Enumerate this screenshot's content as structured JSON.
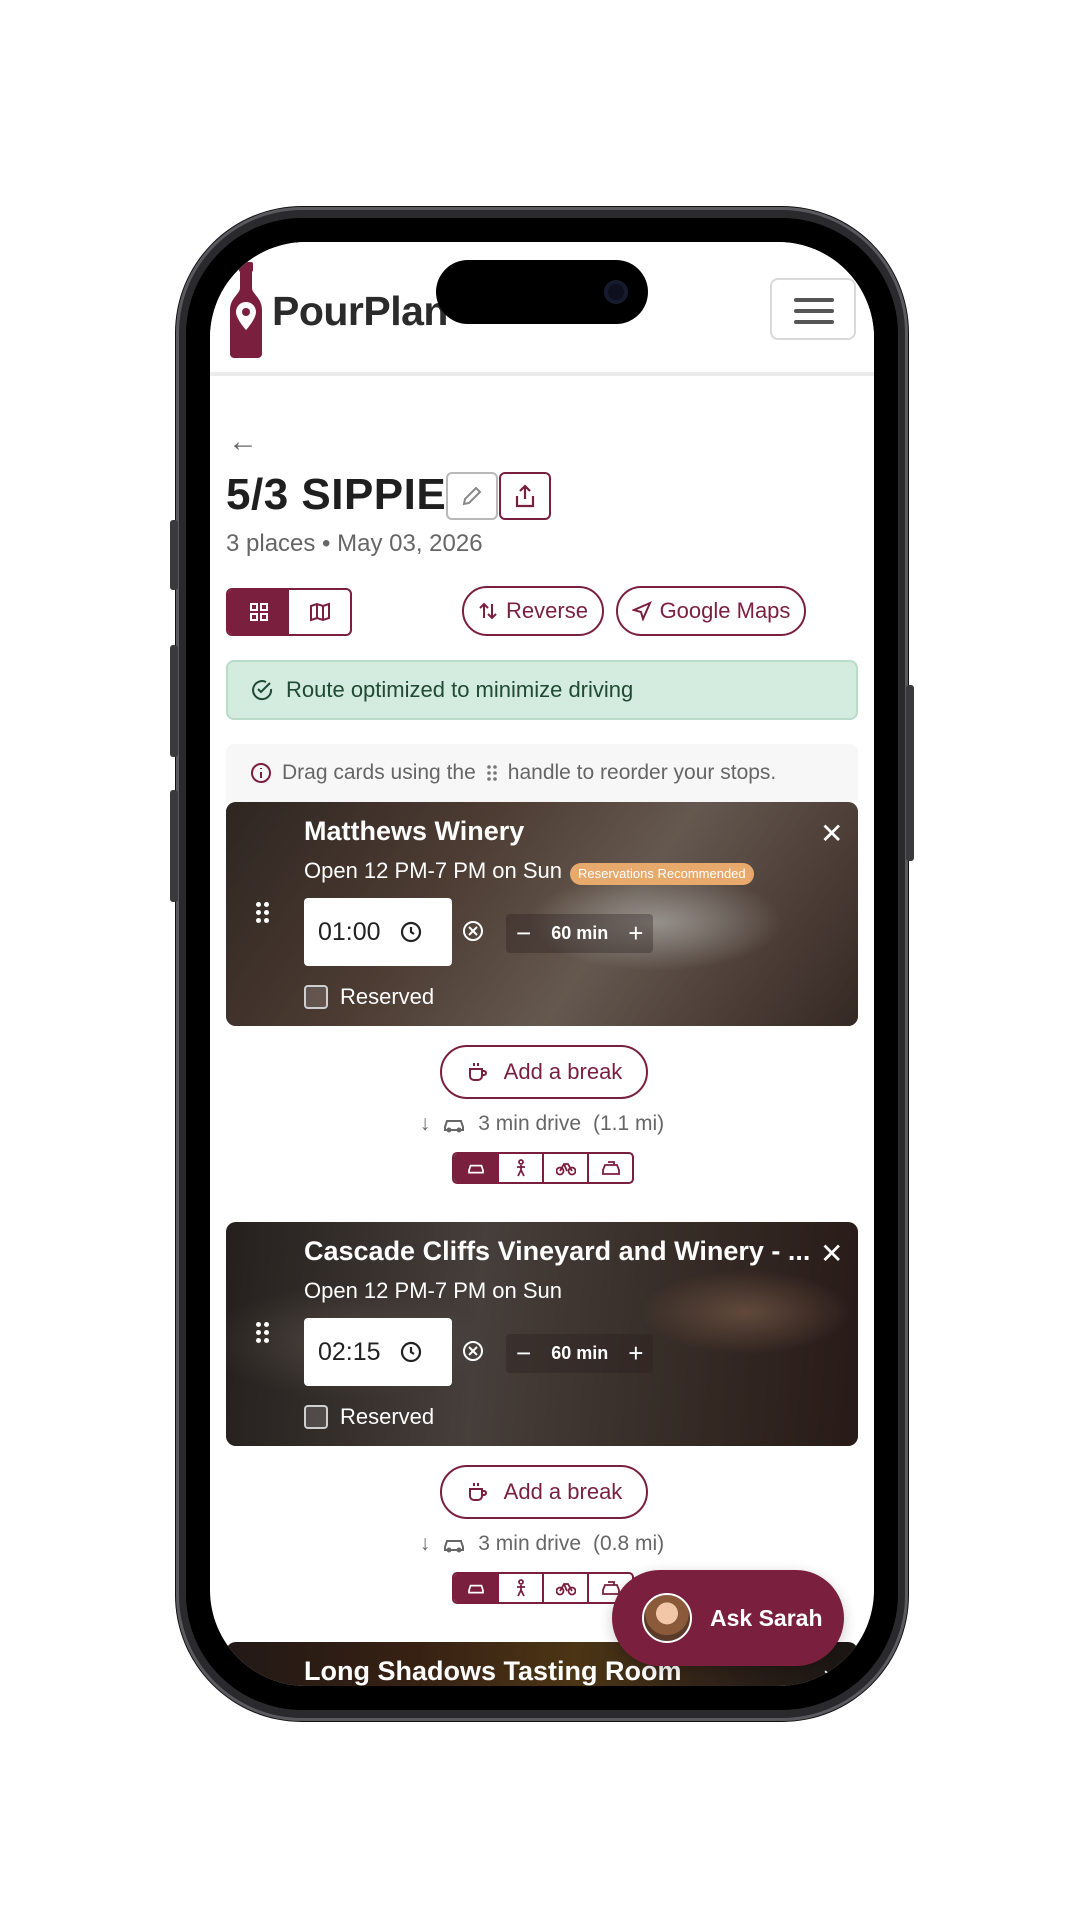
{
  "app": {
    "brand": "PourPlan"
  },
  "trip": {
    "title": "5/3 SIPPIES",
    "subtitle": "3 places • May 03, 2026"
  },
  "controls": {
    "reverse_label": "Reverse",
    "maps_label": "Google Maps",
    "view_active": "grid"
  },
  "banner": {
    "text": "Route optimized to minimize driving"
  },
  "hint": {
    "before": "Drag cards using the",
    "after": "handle to reorder your stops."
  },
  "stops": [
    {
      "name": "Matthews Winery",
      "hours": "Open 12 PM-7 PM on Sun",
      "badge": "Reservations Recommended",
      "time": "01:00",
      "duration": "60 min",
      "reserved_label": "Reserved",
      "reserved": false
    },
    {
      "name": "Cascade Cliffs Vineyard and Winery - ...",
      "hours": "Open 12 PM-7 PM on Sun",
      "time": "02:15",
      "duration": "60 min",
      "reserved_label": "Reserved",
      "reserved": false
    },
    {
      "name": "Long Shadows Tasting Room"
    }
  ],
  "legs": [
    {
      "break_label": "Add a break",
      "drive_time": "3 min drive",
      "distance": "(1.1 mi)",
      "mode_active": "car"
    },
    {
      "break_label": "Add a break",
      "drive_time": "3 min drive",
      "distance": "(0.8 mi)",
      "mode_active": "car"
    }
  ],
  "assistant": {
    "label": "Ask Sarah"
  },
  "colors": {
    "brand": "#7a1f3d",
    "success_bg": "#d4ebdf",
    "badge": "#e8a96c"
  }
}
